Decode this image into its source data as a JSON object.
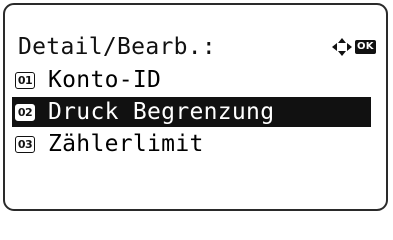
{
  "screen": {
    "title": "Detail/Bearb.:",
    "ok_key_label": "OK",
    "selected_index": 1
  },
  "menu": {
    "items": [
      {
        "number": "01",
        "label": "Konto-ID"
      },
      {
        "number": "02",
        "label": "Druck Begrenzung"
      },
      {
        "number": "03",
        "label": "Zählerlimit"
      }
    ]
  },
  "icons": {
    "nav": "four-way-arrows-icon",
    "ok": "ok-key-icon"
  },
  "colors": {
    "foreground": "#111111",
    "background": "#ffffff",
    "highlight": "#111111"
  }
}
